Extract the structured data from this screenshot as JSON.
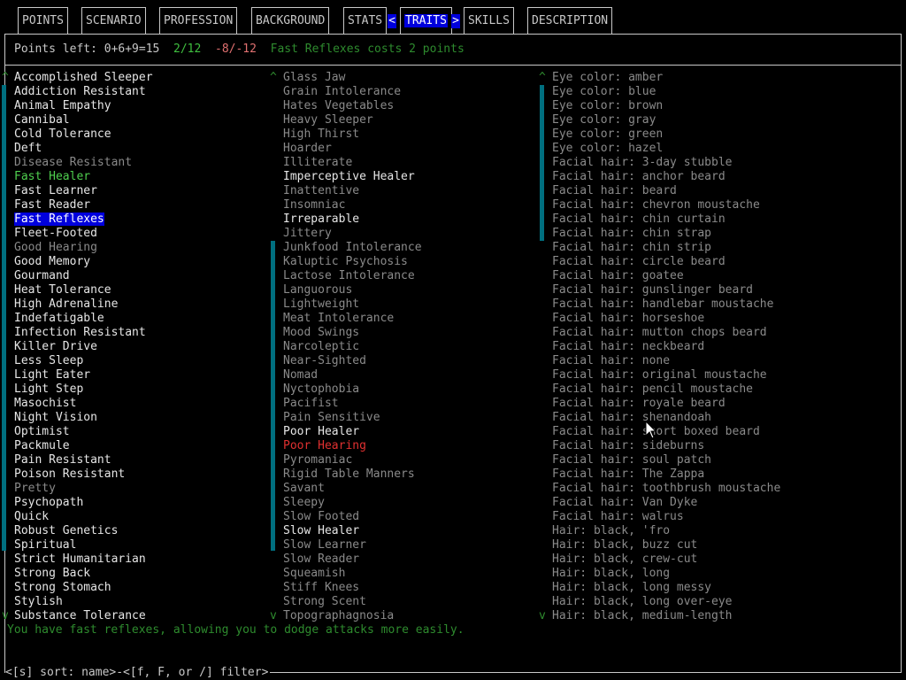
{
  "tabs": {
    "points": "POINTS",
    "scenario": "SCENARIO",
    "profession": "PROFESSION",
    "background": "BACKGROUND",
    "stats": "STATS",
    "traits": "TRAITS",
    "skills": "SKILLS",
    "description": "DESCRIPTION",
    "left_arrow": "<",
    "right_arrow": ">"
  },
  "points_bar": {
    "points_left": "Points left: 0+6+9=15",
    "good": "2/12",
    "bad": "-8/-12",
    "cost": "Fast Reflexes costs 2 points"
  },
  "col1": [
    {
      "label": "Accomplished Sleeper",
      "style": "white"
    },
    {
      "label": "Addiction Resistant",
      "style": "white"
    },
    {
      "label": "Animal Empathy",
      "style": "white"
    },
    {
      "label": "Cannibal",
      "style": "white"
    },
    {
      "label": "Cold Tolerance",
      "style": "white"
    },
    {
      "label": "Deft",
      "style": "white"
    },
    {
      "label": "Disease Resistant",
      "style": "gray"
    },
    {
      "label": "Fast Healer",
      "style": "green"
    },
    {
      "label": "Fast Learner",
      "style": "white"
    },
    {
      "label": "Fast Reader",
      "style": "white"
    },
    {
      "label": "Fast Reflexes",
      "style": "selected"
    },
    {
      "label": "Fleet-Footed",
      "style": "white"
    },
    {
      "label": "Good Hearing",
      "style": "gray"
    },
    {
      "label": "Good Memory",
      "style": "white"
    },
    {
      "label": "Gourmand",
      "style": "white"
    },
    {
      "label": "Heat Tolerance",
      "style": "white"
    },
    {
      "label": "High Adrenaline",
      "style": "white"
    },
    {
      "label": "Indefatigable",
      "style": "white"
    },
    {
      "label": "Infection Resistant",
      "style": "white"
    },
    {
      "label": "Killer Drive",
      "style": "white"
    },
    {
      "label": "Less Sleep",
      "style": "white"
    },
    {
      "label": "Light Eater",
      "style": "white"
    },
    {
      "label": "Light Step",
      "style": "white"
    },
    {
      "label": "Masochist",
      "style": "white"
    },
    {
      "label": "Night Vision",
      "style": "white"
    },
    {
      "label": "Optimist",
      "style": "white"
    },
    {
      "label": "Packmule",
      "style": "white"
    },
    {
      "label": "Pain Resistant",
      "style": "white"
    },
    {
      "label": "Poison Resistant",
      "style": "white"
    },
    {
      "label": "Pretty",
      "style": "gray"
    },
    {
      "label": "Psychopath",
      "style": "white"
    },
    {
      "label": "Quick",
      "style": "white"
    },
    {
      "label": "Robust Genetics",
      "style": "white"
    },
    {
      "label": "Spiritual",
      "style": "white"
    },
    {
      "label": "Strict Humanitarian",
      "style": "white"
    },
    {
      "label": "Strong Back",
      "style": "white"
    },
    {
      "label": "Strong Stomach",
      "style": "white"
    },
    {
      "label": "Stylish",
      "style": "white"
    },
    {
      "label": "Substance Tolerance",
      "style": "white"
    }
  ],
  "col2": [
    {
      "label": "Glass Jaw",
      "style": "gray"
    },
    {
      "label": "Grain Intolerance",
      "style": "gray"
    },
    {
      "label": "Hates Vegetables",
      "style": "gray"
    },
    {
      "label": "Heavy Sleeper",
      "style": "gray"
    },
    {
      "label": "High Thirst",
      "style": "gray"
    },
    {
      "label": "Hoarder",
      "style": "gray"
    },
    {
      "label": "Illiterate",
      "style": "gray"
    },
    {
      "label": "Imperceptive Healer",
      "style": "white"
    },
    {
      "label": "Inattentive",
      "style": "gray"
    },
    {
      "label": "Insomniac",
      "style": "gray"
    },
    {
      "label": "Irreparable",
      "style": "white"
    },
    {
      "label": "Jittery",
      "style": "gray"
    },
    {
      "label": "Junkfood Intolerance",
      "style": "gray"
    },
    {
      "label": "Kaluptic Psychosis",
      "style": "gray"
    },
    {
      "label": "Lactose Intolerance",
      "style": "gray"
    },
    {
      "label": "Languorous",
      "style": "gray"
    },
    {
      "label": "Lightweight",
      "style": "gray"
    },
    {
      "label": "Meat Intolerance",
      "style": "gray"
    },
    {
      "label": "Mood Swings",
      "style": "gray"
    },
    {
      "label": "Narcoleptic",
      "style": "gray"
    },
    {
      "label": "Near-Sighted",
      "style": "gray"
    },
    {
      "label": "Nomad",
      "style": "gray"
    },
    {
      "label": "Nyctophobia",
      "style": "gray"
    },
    {
      "label": "Pacifist",
      "style": "gray"
    },
    {
      "label": "Pain Sensitive",
      "style": "gray"
    },
    {
      "label": "Poor Healer",
      "style": "white"
    },
    {
      "label": "Poor Hearing",
      "style": "red"
    },
    {
      "label": "Pyromaniac",
      "style": "gray"
    },
    {
      "label": "Rigid Table Manners",
      "style": "gray"
    },
    {
      "label": "Savant",
      "style": "gray"
    },
    {
      "label": "Sleepy",
      "style": "gray"
    },
    {
      "label": "Slow Footed",
      "style": "gray"
    },
    {
      "label": "Slow Healer",
      "style": "white"
    },
    {
      "label": "Slow Learner",
      "style": "gray"
    },
    {
      "label": "Slow Reader",
      "style": "gray"
    },
    {
      "label": "Squeamish",
      "style": "gray"
    },
    {
      "label": "Stiff Knees",
      "style": "gray"
    },
    {
      "label": "Strong Scent",
      "style": "gray"
    },
    {
      "label": "Topographagnosia",
      "style": "gray"
    }
  ],
  "col3": [
    {
      "label": "Eye color: amber",
      "style": "gray"
    },
    {
      "label": "Eye color: blue",
      "style": "gray"
    },
    {
      "label": "Eye color: brown",
      "style": "gray"
    },
    {
      "label": "Eye color: gray",
      "style": "gray"
    },
    {
      "label": "Eye color: green",
      "style": "gray"
    },
    {
      "label": "Eye color: hazel",
      "style": "gray"
    },
    {
      "label": "Facial hair: 3-day stubble",
      "style": "gray"
    },
    {
      "label": "Facial hair: anchor beard",
      "style": "gray"
    },
    {
      "label": "Facial hair: beard",
      "style": "gray"
    },
    {
      "label": "Facial hair: chevron moustache",
      "style": "gray"
    },
    {
      "label": "Facial hair: chin curtain",
      "style": "gray"
    },
    {
      "label": "Facial hair: chin strap",
      "style": "gray"
    },
    {
      "label": "Facial hair: chin strip",
      "style": "gray"
    },
    {
      "label": "Facial hair: circle beard",
      "style": "gray"
    },
    {
      "label": "Facial hair: goatee",
      "style": "gray"
    },
    {
      "label": "Facial hair: gunslinger beard",
      "style": "gray"
    },
    {
      "label": "Facial hair: handlebar moustache",
      "style": "gray"
    },
    {
      "label": "Facial hair: horseshoe",
      "style": "gray"
    },
    {
      "label": "Facial hair: mutton chops beard",
      "style": "gray"
    },
    {
      "label": "Facial hair: neckbeard",
      "style": "gray"
    },
    {
      "label": "Facial hair: none",
      "style": "gray"
    },
    {
      "label": "Facial hair: original moustache",
      "style": "gray"
    },
    {
      "label": "Facial hair: pencil moustache",
      "style": "gray"
    },
    {
      "label": "Facial hair: royale beard",
      "style": "gray"
    },
    {
      "label": "Facial hair: shenandoah",
      "style": "gray"
    },
    {
      "label": "Facial hair: short boxed beard",
      "style": "gray"
    },
    {
      "label": "Facial hair: sideburns",
      "style": "gray"
    },
    {
      "label": "Facial hair: soul patch",
      "style": "gray"
    },
    {
      "label": "Facial hair: The Zappa",
      "style": "gray"
    },
    {
      "label": "Facial hair: toothbrush moustache",
      "style": "gray"
    },
    {
      "label": "Facial hair: Van Dyke",
      "style": "gray"
    },
    {
      "label": "Facial hair: walrus",
      "style": "gray"
    },
    {
      "label": "Hair: black, 'fro",
      "style": "gray"
    },
    {
      "label": "Hair: black, buzz cut",
      "style": "gray"
    },
    {
      "label": "Hair: black, crew-cut",
      "style": "gray"
    },
    {
      "label": "Hair: black, long",
      "style": "gray"
    },
    {
      "label": "Hair: black, long messy",
      "style": "gray"
    },
    {
      "label": "Hair: black, long over-eye",
      "style": "gray"
    },
    {
      "label": "Hair: black, medium-length",
      "style": "gray"
    }
  ],
  "scroll": {
    "up": "^",
    "down": "v"
  },
  "description": "You have fast reflexes, allowing you to dodge attacks more easily.",
  "footer": "<[s] sort: name>-<[f, F, or /] filter>"
}
